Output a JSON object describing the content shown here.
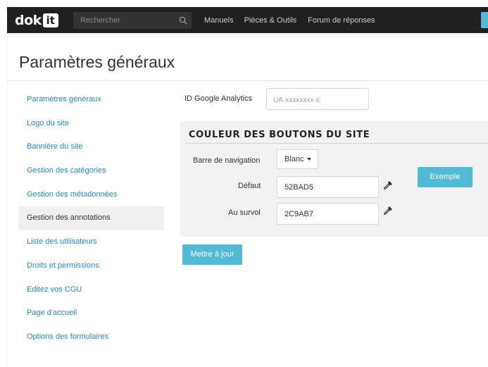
{
  "header": {
    "logo_text": "dok",
    "logo_box": "it",
    "search_placeholder": "Rechercher",
    "nav": [
      "Manuels",
      "Pièces & Outils",
      "Forum de réponses"
    ]
  },
  "page": {
    "title": "Paramètres généraux"
  },
  "sidebar": {
    "items": [
      {
        "label": "Paramètres généraux",
        "active": false
      },
      {
        "label": "Logo du site",
        "active": false
      },
      {
        "label": "Bannière du site",
        "active": false
      },
      {
        "label": "Gestion des catégories",
        "active": false
      },
      {
        "label": "Gestion des métadonnées",
        "active": false
      },
      {
        "label": "Gestion des annotations",
        "active": true
      },
      {
        "label": "Liste des utilisateurs",
        "active": false
      },
      {
        "label": "Droits et permissions",
        "active": false
      },
      {
        "label": "Editez vos CGU",
        "active": false
      },
      {
        "label": "Page d'accueil",
        "active": false
      },
      {
        "label": "Options des formulaires",
        "active": false
      }
    ]
  },
  "form": {
    "ga_label": "ID Google Analytics",
    "ga_placeholder": "UA-xxxxxxxx-x",
    "section_title": "COULEUR DES BOUTONS DU SITE",
    "navbar_label": "Barre de navigation",
    "navbar_value": "Blanc",
    "default_label": "Défaut",
    "default_value": "52BAD5",
    "hover_label": "Au survol",
    "hover_value": "2C9AB7",
    "example_label": "Exemple",
    "update_label": "Mettre à jour"
  },
  "colors": {
    "accent": "#52BAD5",
    "topbar": "#202020",
    "link": "#2b87b8"
  },
  "icons": {
    "search": "search-icon",
    "picker": "eyedropper-icon",
    "caret": "caret-down-icon"
  }
}
